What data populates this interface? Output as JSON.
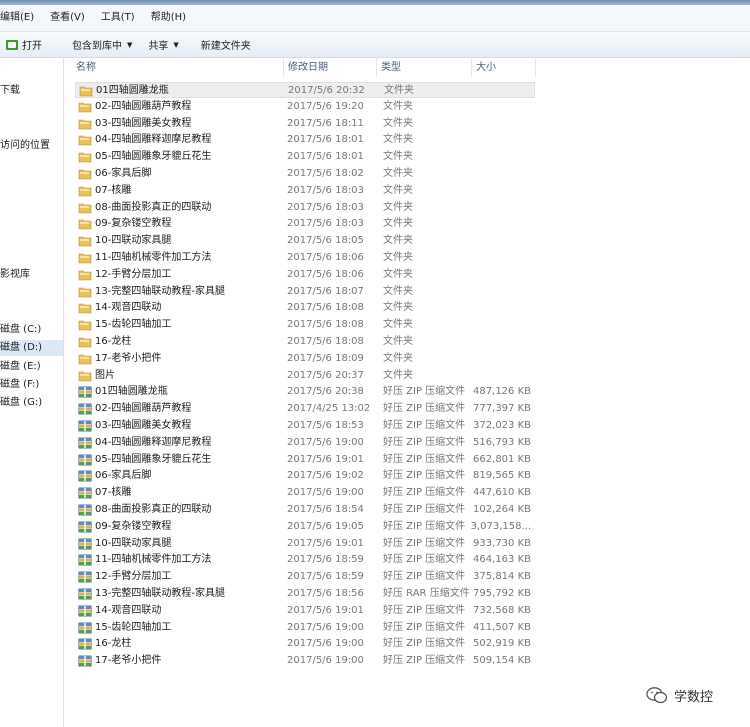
{
  "menu": [
    "编辑(E)",
    "查看(V)",
    "工具(T)",
    "帮助(H)"
  ],
  "toolbar": {
    "open": "打开",
    "include": "包含到库中",
    "share": "共享",
    "new_folder": "新建文件夹"
  },
  "nav": [
    {
      "label": "下载",
      "selected": false
    },
    {
      "label": "访问的位置",
      "selected": false
    },
    {
      "label": "影视库",
      "selected": false
    },
    {
      "label": "磁盘 (C:)",
      "selected": false
    },
    {
      "label": "磁盘 (D:)",
      "selected": true
    },
    {
      "label": "磁盘 (E:)",
      "selected": false
    },
    {
      "label": "磁盘 (F:)",
      "selected": false
    },
    {
      "label": "磁盘 (G:)",
      "selected": false
    }
  ],
  "columns": {
    "name": "名称",
    "date": "修改日期",
    "type": "类型",
    "size": "大小"
  },
  "files": [
    {
      "kind": "folder",
      "name": "01四轴圆雕龙瓶",
      "date": "2017/5/6 20:32",
      "type": "文件夹",
      "size": ""
    },
    {
      "kind": "folder",
      "name": "02-四轴圆雕葫芦教程",
      "date": "2017/5/6 19:20",
      "type": "文件夹",
      "size": ""
    },
    {
      "kind": "folder",
      "name": "03-四轴圆雕美女教程",
      "date": "2017/5/6 18:11",
      "type": "文件夹",
      "size": ""
    },
    {
      "kind": "folder",
      "name": "04-四轴圆雕释迦摩尼教程",
      "date": "2017/5/6 18:01",
      "type": "文件夹",
      "size": ""
    },
    {
      "kind": "folder",
      "name": "05-四轴圆雕象牙貔丘花生",
      "date": "2017/5/6 18:01",
      "type": "文件夹",
      "size": ""
    },
    {
      "kind": "folder",
      "name": "06-家具后脚",
      "date": "2017/5/6 18:02",
      "type": "文件夹",
      "size": ""
    },
    {
      "kind": "folder",
      "name": "07-核雕",
      "date": "2017/5/6 18:03",
      "type": "文件夹",
      "size": ""
    },
    {
      "kind": "folder",
      "name": "08-曲面投影真正的四联动",
      "date": "2017/5/6 18:03",
      "type": "文件夹",
      "size": ""
    },
    {
      "kind": "folder",
      "name": "09-复杂镂空教程",
      "date": "2017/5/6 18:03",
      "type": "文件夹",
      "size": ""
    },
    {
      "kind": "folder",
      "name": "10-四联动家具腿",
      "date": "2017/5/6 18:05",
      "type": "文件夹",
      "size": ""
    },
    {
      "kind": "folder",
      "name": "11-四轴机械零件加工方法",
      "date": "2017/5/6 18:06",
      "type": "文件夹",
      "size": ""
    },
    {
      "kind": "folder",
      "name": "12-手臂分层加工",
      "date": "2017/5/6 18:06",
      "type": "文件夹",
      "size": ""
    },
    {
      "kind": "folder",
      "name": "13-完整四轴联动教程-家具腿",
      "date": "2017/5/6 18:07",
      "type": "文件夹",
      "size": ""
    },
    {
      "kind": "folder",
      "name": "14-观音四联动",
      "date": "2017/5/6 18:08",
      "type": "文件夹",
      "size": ""
    },
    {
      "kind": "folder",
      "name": "15-齿轮四轴加工",
      "date": "2017/5/6 18:08",
      "type": "文件夹",
      "size": ""
    },
    {
      "kind": "folder",
      "name": "16-龙柱",
      "date": "2017/5/6 18:08",
      "type": "文件夹",
      "size": ""
    },
    {
      "kind": "folder",
      "name": "17-老爷小把件",
      "date": "2017/5/6 18:09",
      "type": "文件夹",
      "size": ""
    },
    {
      "kind": "folder",
      "name": "图片",
      "date": "2017/5/6 20:37",
      "type": "文件夹",
      "size": ""
    },
    {
      "kind": "zip",
      "name": "01四轴圆雕龙瓶",
      "date": "2017/5/6 20:38",
      "type": "好压 ZIP 压缩文件",
      "size": "487,126 KB"
    },
    {
      "kind": "zip",
      "name": "02-四轴圆雕葫芦教程",
      "date": "2017/4/25 13:02",
      "type": "好压 ZIP 压缩文件",
      "size": "777,397 KB"
    },
    {
      "kind": "zip",
      "name": "03-四轴圆雕美女教程",
      "date": "2017/5/6 18:53",
      "type": "好压 ZIP 压缩文件",
      "size": "372,023 KB"
    },
    {
      "kind": "zip",
      "name": "04-四轴圆雕释迦摩尼教程",
      "date": "2017/5/6 19:00",
      "type": "好压 ZIP 压缩文件",
      "size": "516,793 KB"
    },
    {
      "kind": "zip",
      "name": "05-四轴圆雕象牙貔丘花生",
      "date": "2017/5/6 19:01",
      "type": "好压 ZIP 压缩文件",
      "size": "662,801 KB"
    },
    {
      "kind": "zip",
      "name": "06-家具后脚",
      "date": "2017/5/6 19:02",
      "type": "好压 ZIP 压缩文件",
      "size": "819,565 KB"
    },
    {
      "kind": "zip",
      "name": "07-核雕",
      "date": "2017/5/6 19:00",
      "type": "好压 ZIP 压缩文件",
      "size": "447,610 KB"
    },
    {
      "kind": "zip",
      "name": "08-曲面投影真正的四联动",
      "date": "2017/5/6 18:54",
      "type": "好压 ZIP 压缩文件",
      "size": "102,264 KB"
    },
    {
      "kind": "zip",
      "name": "09-复杂镂空教程",
      "date": "2017/5/6 19:05",
      "type": "好压 ZIP 压缩文件",
      "size": "3,073,158..."
    },
    {
      "kind": "zip",
      "name": "10-四联动家具腿",
      "date": "2017/5/6 19:01",
      "type": "好压 ZIP 压缩文件",
      "size": "933,730 KB"
    },
    {
      "kind": "zip",
      "name": "11-四轴机械零件加工方法",
      "date": "2017/5/6 18:59",
      "type": "好压 ZIP 压缩文件",
      "size": "464,163 KB"
    },
    {
      "kind": "zip",
      "name": "12-手臂分层加工",
      "date": "2017/5/6 18:59",
      "type": "好压 ZIP 压缩文件",
      "size": "375,814 KB"
    },
    {
      "kind": "zip",
      "name": "13-完整四轴联动教程-家具腿",
      "date": "2017/5/6 18:56",
      "type": "好压 RAR 压缩文件",
      "size": "795,792 KB"
    },
    {
      "kind": "zip",
      "name": "14-观音四联动",
      "date": "2017/5/6 19:01",
      "type": "好压 ZIP 压缩文件",
      "size": "732,568 KB"
    },
    {
      "kind": "zip",
      "name": "15-齿轮四轴加工",
      "date": "2017/5/6 19:00",
      "type": "好压 ZIP 压缩文件",
      "size": "411,507 KB"
    },
    {
      "kind": "zip",
      "name": "16-龙柱",
      "date": "2017/5/6 19:00",
      "type": "好压 ZIP 压缩文件",
      "size": "502,919 KB"
    },
    {
      "kind": "zip",
      "name": "17-老爷小把件",
      "date": "2017/5/6 19:00",
      "type": "好压 ZIP 压缩文件",
      "size": "509,154 KB"
    }
  ],
  "watermark": "学数控",
  "colors": {
    "folder": "#e8c15a",
    "zip_top": "#5b8cc7",
    "zip_bottom": "#4aa24a",
    "accent": "#dde8f6"
  }
}
